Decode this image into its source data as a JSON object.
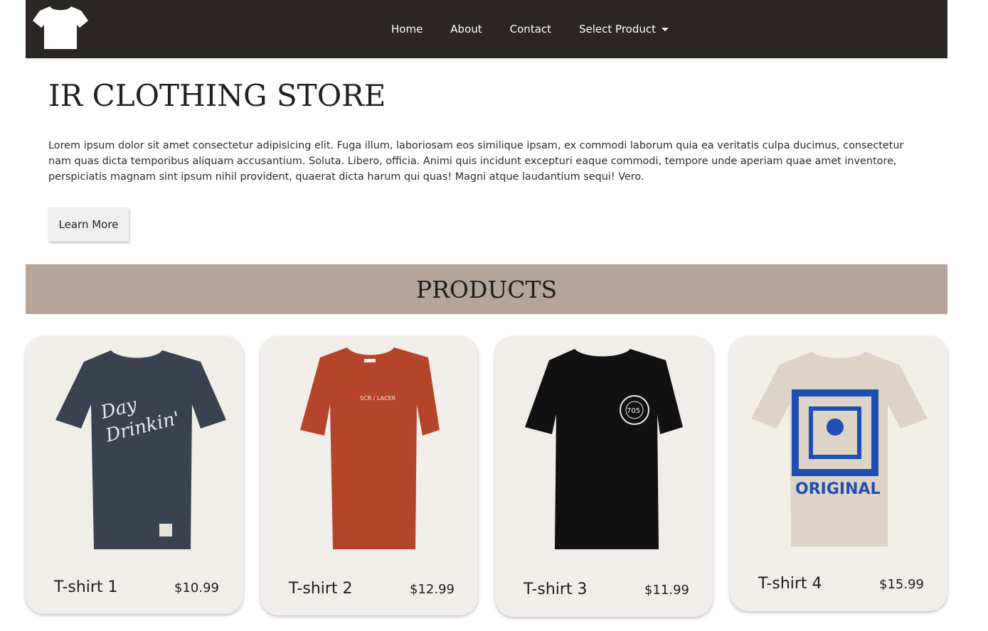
{
  "navbar": {
    "logo_icon": "tshirt-icon",
    "links": [
      "Home",
      "About",
      "Contact"
    ],
    "dropdown_label": "Select Product",
    "background": "#2b2624"
  },
  "hero": {
    "title": "IR CLOTHING STORE",
    "text": "Lorem ipsum dolor sit amet consectetur adipisicing elit. Fuga illum, laboriosam eos similique ipsam, ex commodi laborum quia ea veritatis culpa ducimus, consectetur nam quas dicta temporibus aliquam accusantium. Soluta. Libero, officia. Animi quis incidunt excepturi eaque commodi, tempore unde aperiam quae amet inventore, perspiciatis magnam sint ipsum nihil provident, quaerat dicta harum qui quas! Magni atque laudantium sequi! Vero.",
    "button_label": "Learn More"
  },
  "products": {
    "heading": "PRODUCTS",
    "band_color": "#b5a49a",
    "items": [
      {
        "name": "T-shirt 1",
        "price": "$10.99",
        "shirt_color": "#3a4250",
        "print_text": "Day Drinkin'"
      },
      {
        "name": "T-shirt 2",
        "price": "$12.99",
        "shirt_color": "#b5452a",
        "print_text": "SCR / LACER"
      },
      {
        "name": "T-shirt 3",
        "price": "$11.99",
        "shirt_color": "#111111",
        "print_text": "705"
      },
      {
        "name": "T-shirt 4",
        "price": "$15.99",
        "shirt_color": "#ddd3c6",
        "print_text": "ORIGINAL"
      }
    ]
  }
}
